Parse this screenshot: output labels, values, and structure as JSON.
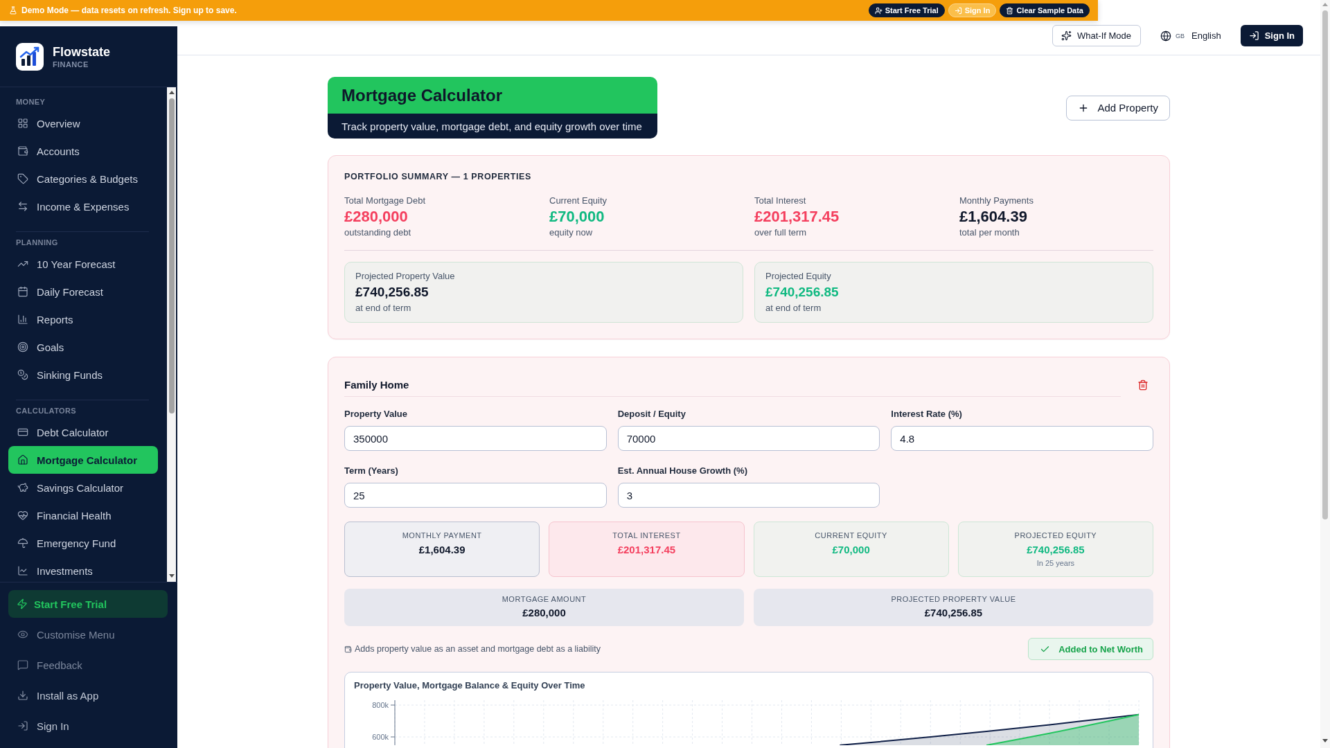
{
  "banner": {
    "message": "Demo Mode — data resets on refresh. Sign up to save.",
    "buttons": [
      {
        "label": "Start Free Trial",
        "kind": "primary"
      },
      {
        "label": "Sign In",
        "kind": "secondary"
      },
      {
        "label": "Clear Sample Data",
        "kind": "primary"
      }
    ]
  },
  "sidebar": {
    "brand": {
      "name": "Flowstate",
      "tagline": "FINANCE"
    },
    "sections": [
      {
        "title": "MONEY",
        "items": [
          {
            "label": "Overview",
            "selected": false
          },
          {
            "label": "Accounts",
            "selected": false
          },
          {
            "label": "Categories & Budgets",
            "selected": false
          },
          {
            "label": "Income & Expenses",
            "selected": false
          }
        ]
      },
      {
        "title": "PLANNING",
        "items": [
          {
            "label": "10 Year Forecast",
            "selected": false
          },
          {
            "label": "Daily Forecast",
            "selected": false
          },
          {
            "label": "Reports",
            "selected": false
          },
          {
            "label": "Goals",
            "selected": false
          },
          {
            "label": "Sinking Funds",
            "selected": false
          }
        ]
      },
      {
        "title": "CALCULATORS",
        "items": [
          {
            "label": "Debt Calculator",
            "selected": false
          },
          {
            "label": "Mortgage Calculator",
            "selected": true
          },
          {
            "label": "Savings Calculator",
            "selected": false
          },
          {
            "label": "Financial Health",
            "selected": false
          },
          {
            "label": "Emergency Fund",
            "selected": false
          },
          {
            "label": "Investments",
            "selected": false
          }
        ]
      }
    ],
    "footer": [
      {
        "label": "Start Free Trial",
        "kind": "trial",
        "muted": false
      },
      {
        "label": "Customise Menu",
        "kind": "link",
        "muted": true
      },
      {
        "label": "Feedback",
        "kind": "link",
        "muted": true
      },
      {
        "label": "Install as App",
        "kind": "link",
        "muted": false
      },
      {
        "label": "Sign In",
        "kind": "link",
        "muted": false
      }
    ]
  },
  "header": {
    "what_if": "What-If Mode",
    "language": {
      "flag": "GB",
      "label": "English"
    },
    "sign_in": "Sign In"
  },
  "page": {
    "title": "Mortgage Calculator",
    "subtitle": "Track property value, mortgage debt, and equity growth over time",
    "add_button": "Add Property"
  },
  "portfolio_summary": {
    "title": "PORTFOLIO SUMMARY — 1 PROPERTIES",
    "stats": [
      {
        "label": "Total Mortgage Debt",
        "value": "£280,000",
        "note": "outstanding debt",
        "kind": "negative"
      },
      {
        "label": "Current Equity",
        "value": "£70,000",
        "note": "equity now",
        "kind": "positive"
      },
      {
        "label": "Total Interest",
        "value": "£201,317.45",
        "note": "over full term",
        "kind": "negative"
      },
      {
        "label": "Monthly Payments",
        "value": "£1,604.39",
        "note": "total per month",
        "kind": "neutral"
      }
    ],
    "projections": [
      {
        "label": "Projected Property Value",
        "value": "£740,256.85",
        "note": "at end of term",
        "kind": "neutral"
      },
      {
        "label": "Projected Equity",
        "value": "£740,256.85",
        "note": "at end of term",
        "kind": "positive"
      }
    ]
  },
  "property": {
    "name": "Family Home",
    "fields": [
      {
        "label": "Property Value",
        "value": "350000"
      },
      {
        "label": "Deposit / Equity",
        "value": "70000"
      },
      {
        "label": "Interest Rate (%)",
        "value": "4.8"
      },
      {
        "label": "Term (Years)",
        "value": "25"
      },
      {
        "label": "Est. Annual House Growth (%)",
        "value": "3"
      }
    ],
    "tiles": [
      {
        "label": "MONTHLY PAYMENT",
        "value": "£1,604.39",
        "kind": "neutral"
      },
      {
        "label": "TOTAL INTEREST",
        "value": "£201,317.45",
        "kind": "negative"
      },
      {
        "label": "CURRENT EQUITY",
        "value": "£70,000",
        "kind": "positive"
      },
      {
        "label": "PROJECTED EQUITY",
        "value": "£740,256.85",
        "note": "In 25 years",
        "kind": "positive"
      }
    ],
    "totals": [
      {
        "label": "MORTGAGE AMOUNT",
        "value": "£280,000"
      },
      {
        "label": "PROJECTED PROPERTY VALUE",
        "value": "£740,256.85"
      }
    ],
    "net_worth_note": "Adds property value as an asset and mortgage debt as a liability",
    "net_worth_button": {
      "label": "Added to Net Worth",
      "added": true
    },
    "chart": {
      "title": "Property Value, Mortgage Balance & Equity Over Time",
      "y_labels": [
        "800k",
        "600k"
      ]
    }
  }
}
